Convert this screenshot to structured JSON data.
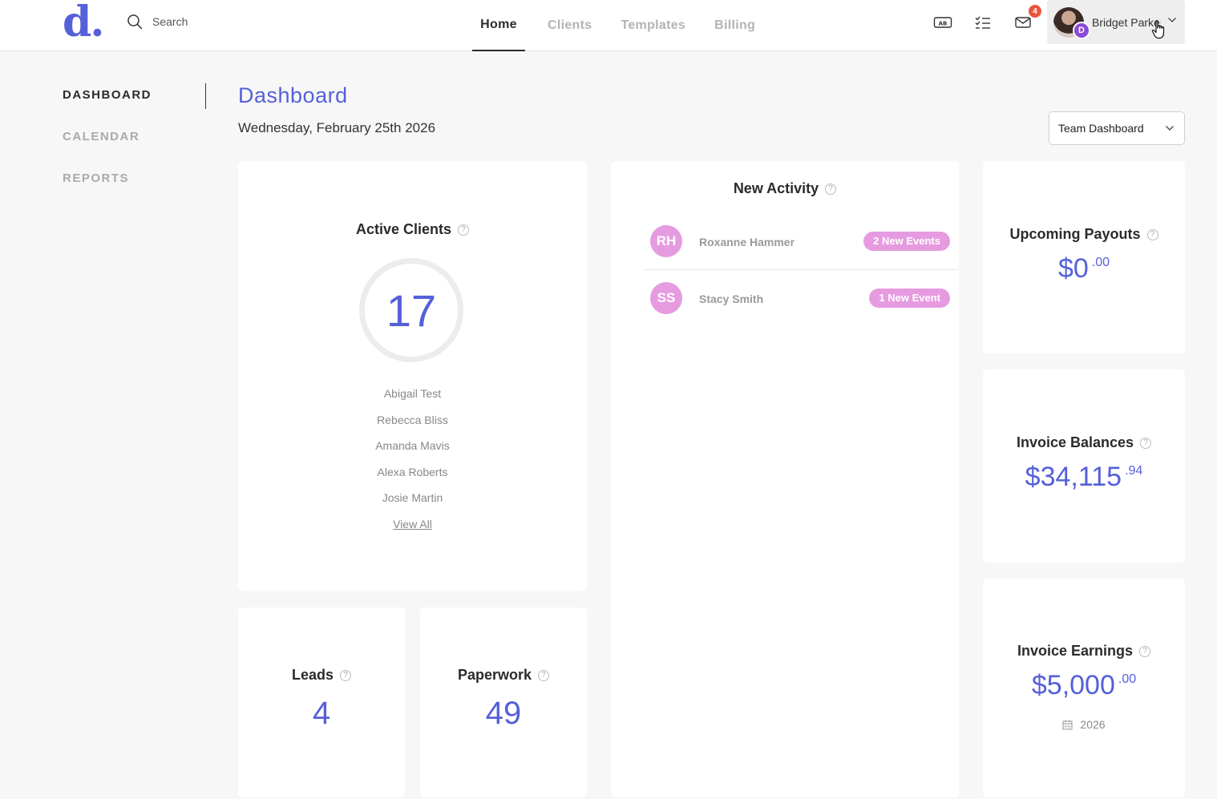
{
  "app": {
    "logo": "d."
  },
  "search": {
    "label": "Search"
  },
  "nav": {
    "tabs": [
      {
        "label": "Home",
        "active": true
      },
      {
        "label": "Clients",
        "active": false
      },
      {
        "label": "Templates",
        "active": false
      },
      {
        "label": "Billing",
        "active": false
      }
    ]
  },
  "toolbar": {
    "ab_icon_text": "AB",
    "inbox_badge": "4"
  },
  "user": {
    "name": "Bridget Parker",
    "avatar_badge": "D"
  },
  "sidebar": {
    "items": [
      {
        "label": "DASHBOARD",
        "active": true
      },
      {
        "label": "CALENDAR",
        "active": false
      },
      {
        "label": "REPORTS",
        "active": false
      }
    ]
  },
  "page": {
    "title": "Dashboard",
    "date": "Wednesday, February 25th 2026"
  },
  "dashboard_select": {
    "value": "Team Dashboard"
  },
  "active_clients": {
    "title": "Active Clients",
    "count": "17",
    "clients": [
      "Abigail Test",
      "Rebecca Bliss",
      "Amanda Mavis",
      "Alexa Roberts",
      "Josie Martin"
    ],
    "view_all": "View All"
  },
  "leads": {
    "title": "Leads",
    "count": "4"
  },
  "paperwork": {
    "title": "Paperwork",
    "count": "49"
  },
  "new_activity": {
    "title": "New Activity",
    "items": [
      {
        "initials": "RH",
        "name": "Roxanne Hammer",
        "events": "2 New Events"
      },
      {
        "initials": "SS",
        "name": "Stacy Smith",
        "events": "1 New Event"
      }
    ]
  },
  "upcoming_payouts": {
    "title": "Upcoming Payouts",
    "amount": "$0",
    "cents": ".00"
  },
  "invoice_balances": {
    "title": "Invoice Balances",
    "amount": "$34,115",
    "cents": ".94"
  },
  "invoice_earnings": {
    "title": "Invoice Earnings",
    "amount": "$5,000",
    "cents": ".00",
    "year": "2026"
  },
  "colors": {
    "accent": "#5560d9",
    "pill": "#e69be0",
    "badge": "#e8553e",
    "avatar_badge": "#8a4bd6"
  }
}
